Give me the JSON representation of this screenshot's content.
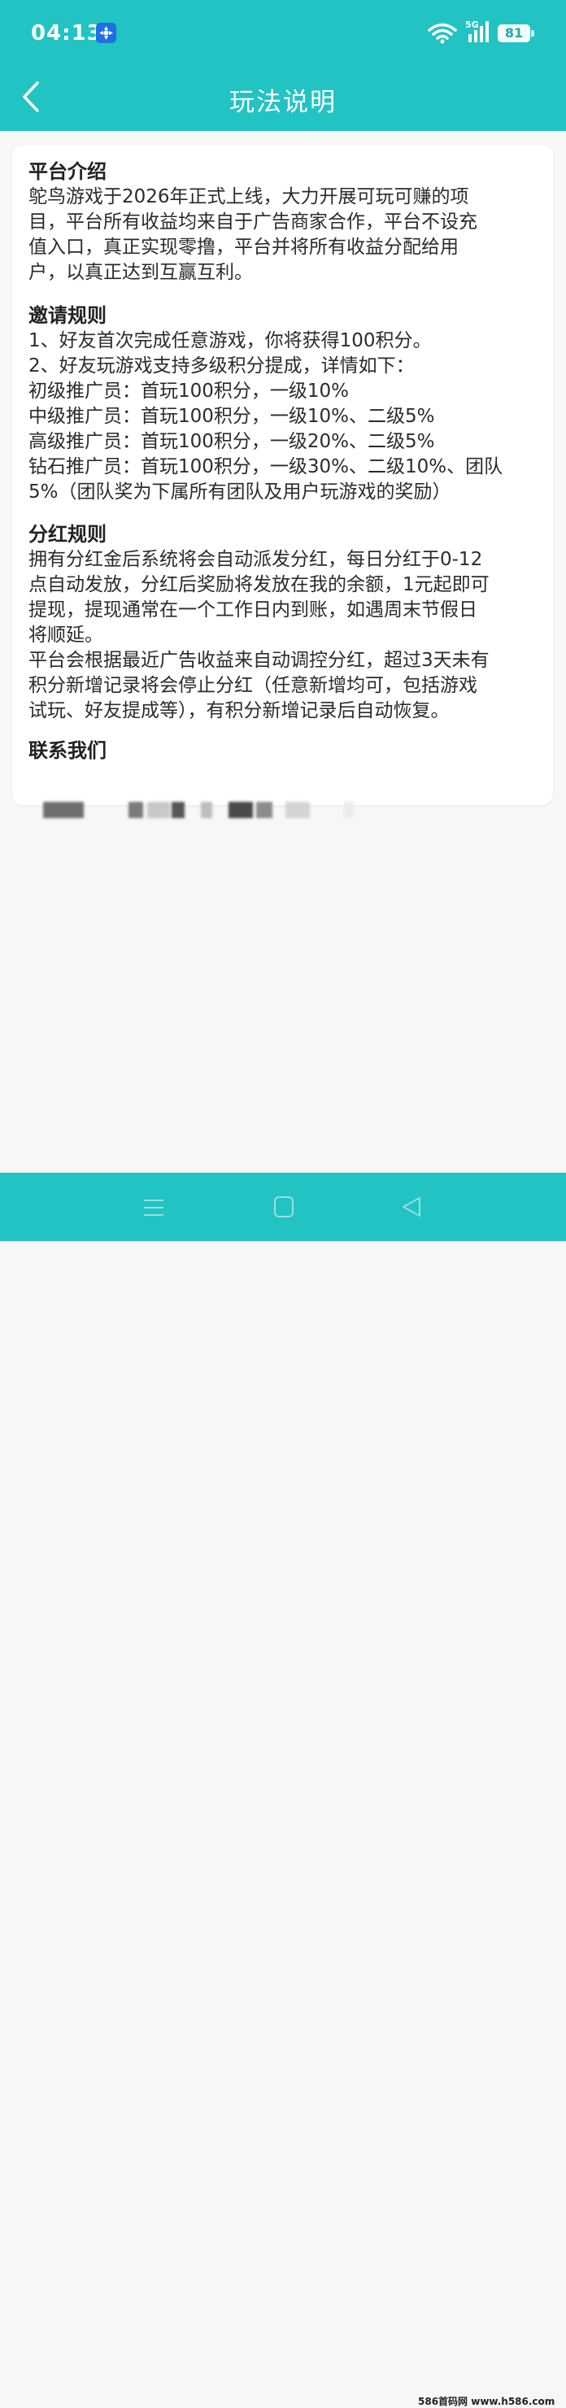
{
  "status_bar": {
    "time": "04:13",
    "network": "5G",
    "battery": "81"
  },
  "nav": {
    "title": "玩法说明"
  },
  "sections": {
    "intro": {
      "title": "平台介绍",
      "lines": [
        "鸵鸟游戏于2026年正式上线，大力开展可玩可赚的项",
        "目，平台所有收益均来自于广告商家合作，平台不设充",
        "值入口，真正实现零撸，平台并将所有收益分配给用",
        "户，以真正达到互赢互利。"
      ]
    },
    "invite": {
      "title": "邀请规则",
      "lines": [
        "1、好友首次完成任意游戏，你将获得100积分。",
        "2、好友玩游戏支持多级积分提成，详情如下：",
        "初级推广员：首玩100积分，一级10%",
        "中级推广员：首玩100积分，一级10%、二级5%",
        "高级推广员：首玩100积分，一级20%、二级5%",
        "钻石推广员：首玩100积分，一级30%、二级10%、团队",
        "5%（团队奖为下属所有团队及用户玩游戏的奖励）"
      ]
    },
    "dividend": {
      "title": "分红规则",
      "lines": [
        "拥有分红金后系统将会自动派发分红，每日分红于0-12",
        "点自动发放，分红后奖励将发放在我的余额，1元起即可",
        "提现，提现通常在一个工作日内到账，如遇周末节假日",
        "将顺延。",
        "平台会根据最近广告收益来自动调控分红，超过3天未有",
        "积分新增记录将会停止分红（任意新增均可，包括游戏",
        "试玩、好友提成等），有积分新增记录后自动恢复。"
      ]
    },
    "contact": {
      "title": "联系我们"
    }
  },
  "watermark": "586首码网 www.h586.com",
  "colors": {
    "accent": "#22c3c3",
    "background": "#f7f7f7",
    "card": "#ffffff",
    "text": "#2b2b2b"
  },
  "icons": {
    "status": [
      "app-notification-icon",
      "wifi-icon",
      "signal-icon",
      "battery-icon"
    ],
    "nav": [
      "back-arrow-icon"
    ],
    "system_nav": [
      "menu-icon",
      "home-icon",
      "back-triangle-icon"
    ]
  }
}
